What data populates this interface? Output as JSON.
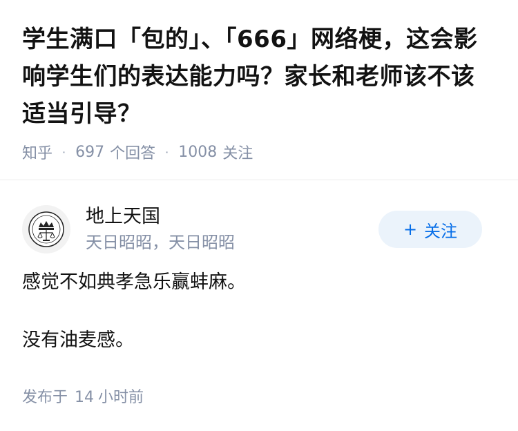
{
  "question": {
    "title": "学生满口「包的」、「666」网络梗，这会影响学生们的表达能力吗？家长和老师该不该适当引导？",
    "meta": {
      "source": "知乎",
      "answers_count": "697",
      "answers_label": "个回答",
      "followers_count": "1008",
      "followers_label": "关注",
      "separator": "·"
    }
  },
  "answer": {
    "author": {
      "name": "地上天国",
      "bio": "天日昭昭，天日昭昭",
      "avatar_icon": "crown-scales-emblem-icon"
    },
    "follow_button": {
      "plus": "+",
      "label": "关注"
    },
    "paragraphs": [
      "感觉不如典孝急乐赢蚌麻。",
      "没有油麦感。"
    ],
    "published": {
      "label": "发布于",
      "number": "14",
      "unit": "小时前"
    }
  },
  "colors": {
    "accent": "#056de8",
    "button_bg": "#ebf3fb",
    "meta_text": "#8590a6",
    "main_text": "#121212"
  }
}
